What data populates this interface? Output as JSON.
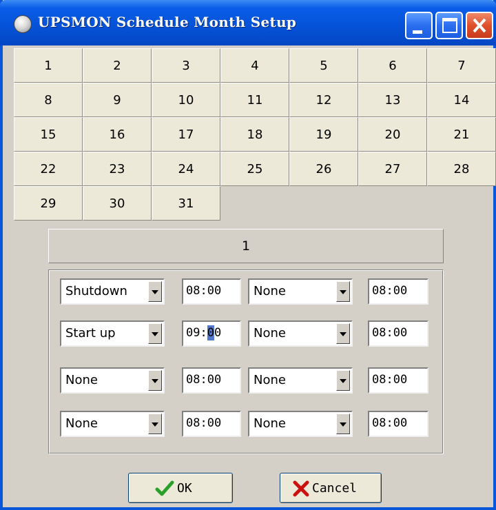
{
  "window": {
    "title": "UPSMON Schedule Month Setup"
  },
  "days": [
    "1",
    "2",
    "3",
    "4",
    "5",
    "6",
    "7",
    "8",
    "9",
    "10",
    "11",
    "12",
    "13",
    "14",
    "15",
    "16",
    "17",
    "18",
    "19",
    "20",
    "21",
    "22",
    "23",
    "24",
    "25",
    "26",
    "27",
    "28",
    "29",
    "30",
    "31"
  ],
  "selected_day": "1",
  "schedule_rows": [
    {
      "action1": "Shutdown",
      "time1": "08:00",
      "action2": "None",
      "time2": "08:00"
    },
    {
      "action1": "Start up",
      "time1": "09:00",
      "action2": "None",
      "time2": "08:00"
    },
    {
      "action1": "None",
      "time1": "08:00",
      "action2": "None",
      "time2": "08:00"
    },
    {
      "action1": "None",
      "time1": "08:00",
      "action2": "None",
      "time2": "08:00"
    }
  ],
  "buttons": {
    "ok": "OK",
    "cancel": "Cancel"
  },
  "colors": {
    "titlebar": "#0553d8",
    "face": "#d4d0c8",
    "day_button": "#ece9d8",
    "ok_check": "#2aa02a",
    "cancel_x": "#cc1010"
  }
}
